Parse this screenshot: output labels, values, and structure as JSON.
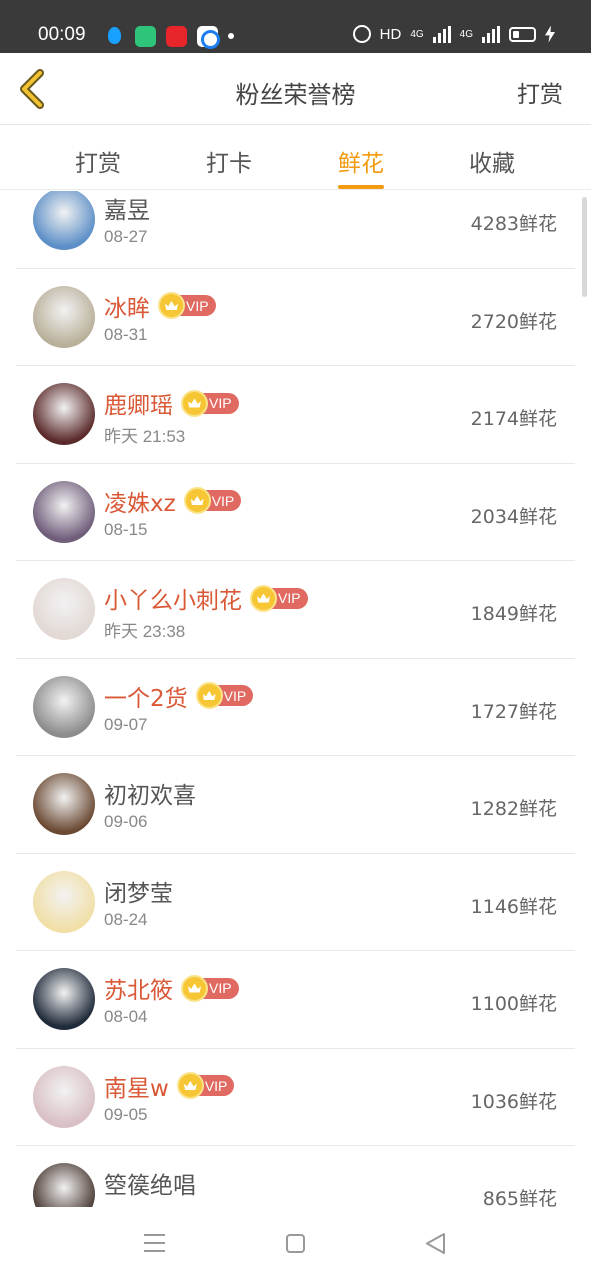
{
  "status_bar": {
    "time": "00:09",
    "hd_label": "HD",
    "signal_1": "4G",
    "signal_2": "4G"
  },
  "header": {
    "title": "粉丝荣誉榜",
    "right_action": "打赏"
  },
  "tabs": [
    {
      "label": "打赏",
      "active": false
    },
    {
      "label": "打卡",
      "active": false
    },
    {
      "label": "鲜花",
      "active": true
    },
    {
      "label": "收藏",
      "active": false
    }
  ],
  "vip_label": "VIP",
  "fans": [
    {
      "name": "嘉昱",
      "date": "08-27",
      "count": "4283鲜花",
      "vip": false,
      "avatar_color": "#5c8fc7"
    },
    {
      "name": "冰眸",
      "date": "08-31",
      "count": "2720鲜花",
      "vip": true,
      "avatar_color": "#b9b09a"
    },
    {
      "name": "鹿卿瑶",
      "date": "昨天 21:53",
      "count": "2174鲜花",
      "vip": true,
      "avatar_color": "#5b2a2a"
    },
    {
      "name": "凌姝xz",
      "date": "08-15",
      "count": "2034鲜花",
      "vip": true,
      "avatar_color": "#6f5d7a"
    },
    {
      "name": "小丫么小刺花",
      "date": "昨天 23:38",
      "count": "1849鲜花",
      "vip": true,
      "avatar_color": "#e2d8d4"
    },
    {
      "name": "一个2货",
      "date": "09-07",
      "count": "1727鲜花",
      "vip": true,
      "avatar_color": "#8c8c8c"
    },
    {
      "name": "初初欢喜",
      "date": "09-06",
      "count": "1282鲜花",
      "vip": false,
      "avatar_color": "#6b4a34"
    },
    {
      "name": "闭梦莹",
      "date": "08-24",
      "count": "1146鲜花",
      "vip": false,
      "avatar_color": "#f1dfa6"
    },
    {
      "name": "苏北筱",
      "date": "08-04",
      "count": "1100鲜花",
      "vip": true,
      "avatar_color": "#1f2a3a"
    },
    {
      "name": "南星w",
      "date": "09-05",
      "count": "1036鲜花",
      "vip": true,
      "avatar_color": "#d9c0c4"
    },
    {
      "name": "箜篌绝唱",
      "date": "",
      "count": "865鲜花",
      "vip": false,
      "avatar_color": "#4a3a33"
    }
  ]
}
